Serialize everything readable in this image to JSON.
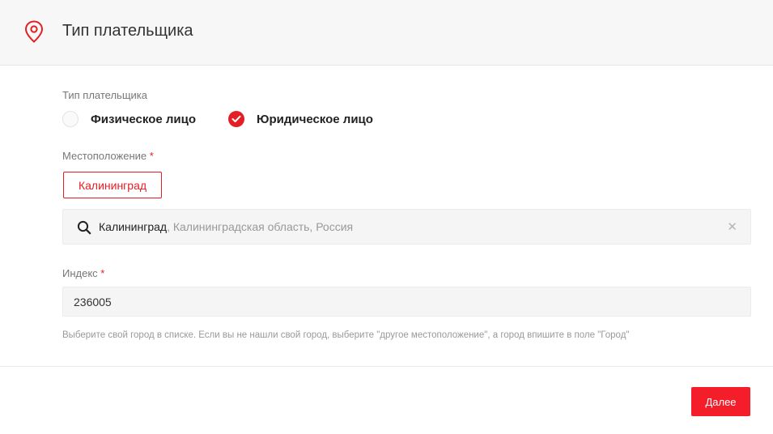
{
  "header": {
    "icon": "map-pin-icon",
    "title": "Тип плательщика"
  },
  "payer_type": {
    "label": "Тип плательщика",
    "options": [
      {
        "label": "Физическое лицо",
        "selected": false
      },
      {
        "label": "Юридическое лицо",
        "selected": true
      }
    ]
  },
  "location": {
    "label": "Местоположение",
    "required_mark": "*",
    "selected_city": "Калининград",
    "search": {
      "icon": "search-icon",
      "value_main": "Калининград",
      "value_rest": ", Калининградская область, Россия",
      "clear_icon": "close-icon"
    }
  },
  "index": {
    "label": "Индекс",
    "required_mark": "*",
    "value": "236005"
  },
  "hint": "Выберите свой город в списке. Если вы не нашли свой город, выберите \"другое местоположение\", а город впишите в поле \"Город\"",
  "actions": {
    "next_label": "Далее"
  },
  "colors": {
    "accent": "#e31e24",
    "button": "#f31e2a"
  }
}
